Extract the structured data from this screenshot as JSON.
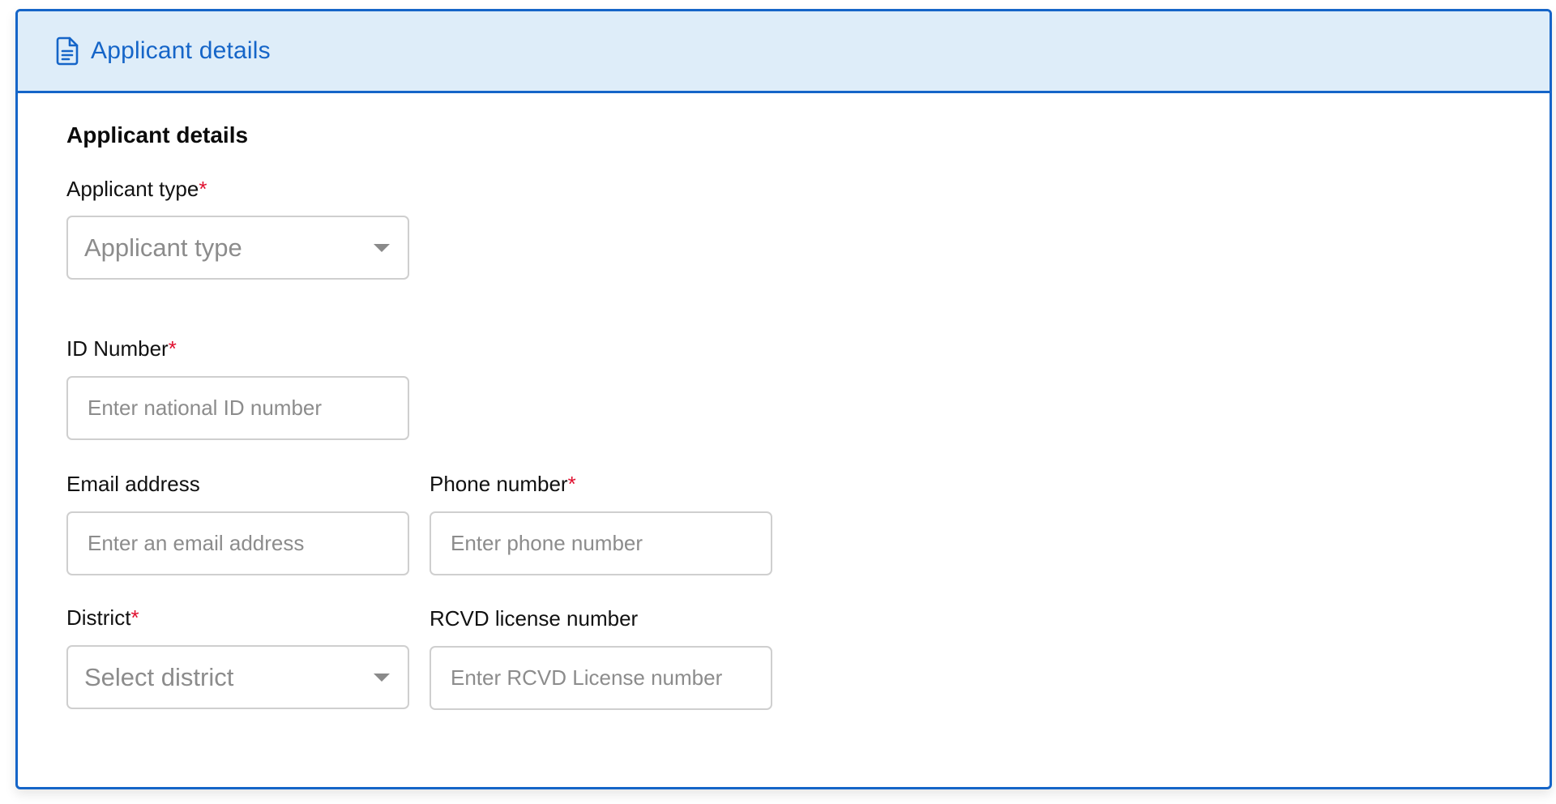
{
  "header": {
    "icon": "document-icon",
    "title": "Applicant details"
  },
  "form": {
    "section_title": "Applicant details",
    "required_marker": "*",
    "fields": {
      "applicant_type": {
        "label": "Applicant type",
        "required": true,
        "placeholder": "Applicant type",
        "control": "select"
      },
      "id_number": {
        "label": "ID Number",
        "required": true,
        "placeholder": "Enter national ID number",
        "control": "text"
      },
      "email": {
        "label": "Email address",
        "required": false,
        "placeholder": "Enter an email address",
        "control": "text"
      },
      "phone": {
        "label": "Phone number",
        "required": true,
        "placeholder": "Enter phone number",
        "control": "text"
      },
      "district": {
        "label": "District",
        "required": true,
        "placeholder": "Select district",
        "control": "select"
      },
      "rcvd_license": {
        "label": "RCVD license number",
        "required": false,
        "placeholder": "Enter RCVD License number",
        "control": "text"
      }
    }
  },
  "colors": {
    "accent": "#1565c8",
    "header_background": "#deedf9",
    "required": "#e0102f",
    "placeholder": "#8c8c8c",
    "input_border": "#cfcfcf"
  }
}
